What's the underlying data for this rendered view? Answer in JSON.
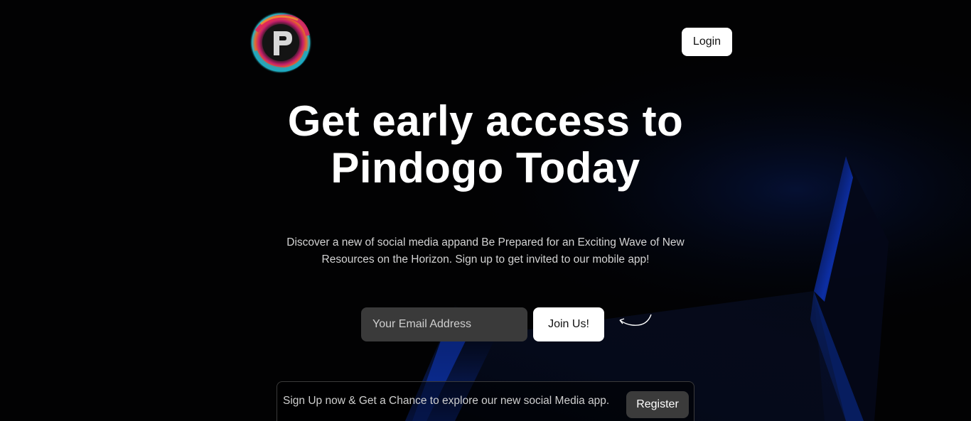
{
  "header": {
    "logo_alt": "P",
    "login_label": "Login"
  },
  "hero": {
    "headline_line1": "Get early access to",
    "headline_line2": "Pindogo Today",
    "subtitle": "Discover a new of social media appand Be Prepared for an Exciting Wave of New Resources on the Horizon. Sign up to get invited to our mobile app!"
  },
  "signup": {
    "email_placeholder": "Your Email Address",
    "email_value": "",
    "join_label": "Join Us!",
    "arrow_icon": "curved-arrow-left-icon"
  },
  "cta": {
    "text": "Sign Up now & Get a Chance to explore our new social Media app.",
    "register_label": "Register"
  },
  "colors": {
    "background": "#020203",
    "accent_blue": "#0d3cb8",
    "button_light": "#ffffff",
    "input_bg": "#3a3a3a"
  }
}
